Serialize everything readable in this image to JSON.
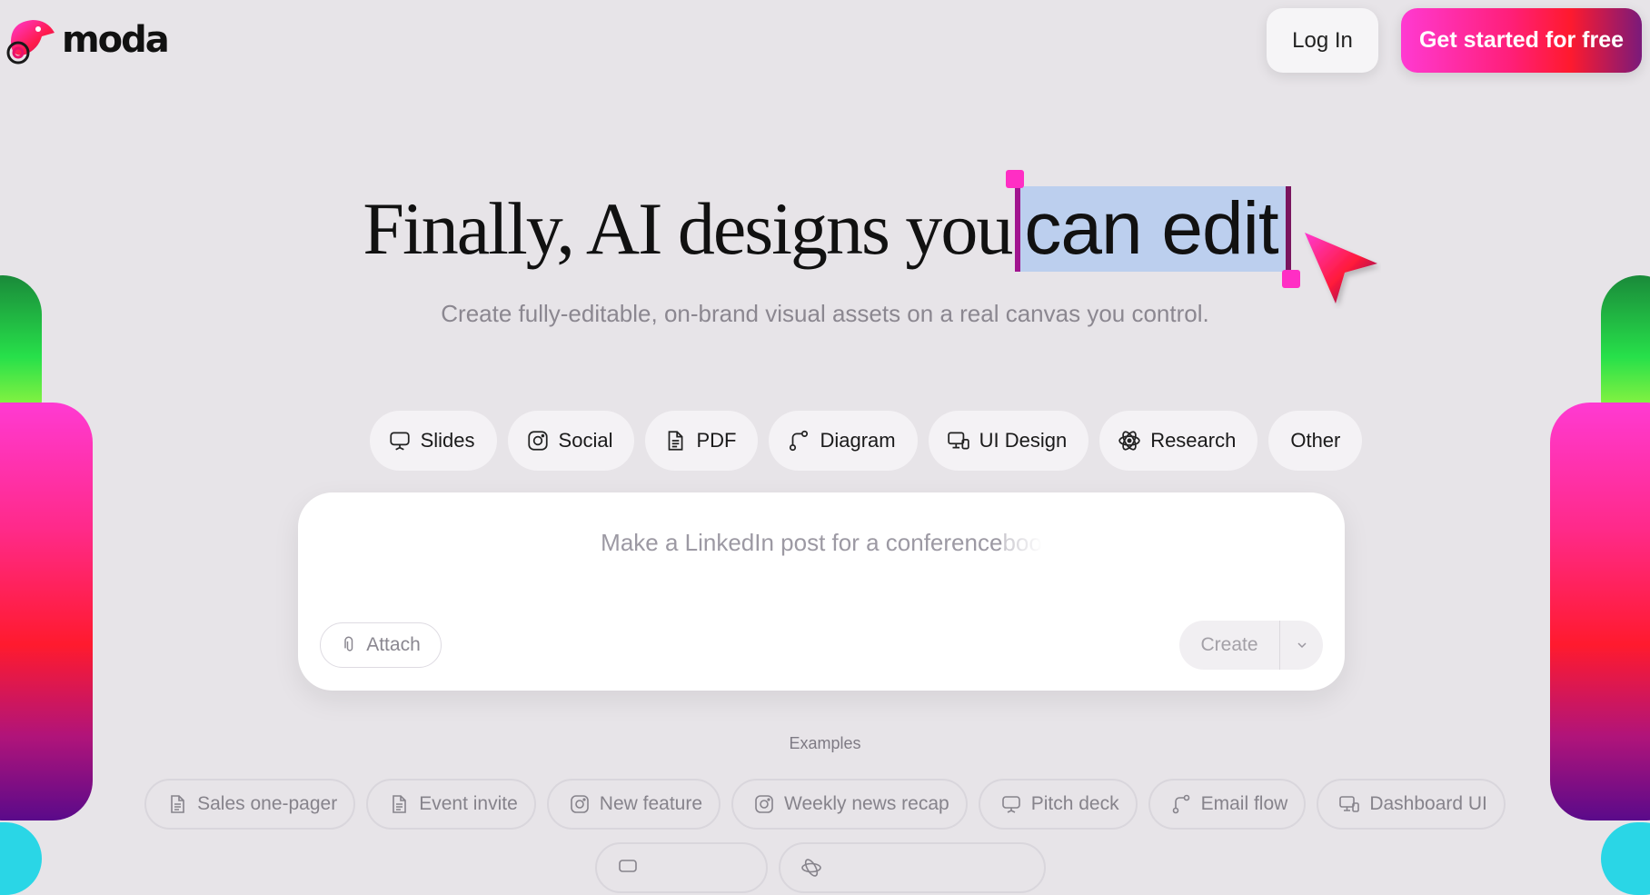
{
  "brand": {
    "name": "moda"
  },
  "header": {
    "login_label": "Log In",
    "cta_label": "Get started for free"
  },
  "hero": {
    "headline_prefix": "Finally, AI designs you",
    "headline_highlight": "can edit",
    "subheadline": "Create fully-editable, on-brand visual assets on a real canvas you control."
  },
  "categories": [
    {
      "label": "Slides",
      "icon": "presentation-icon"
    },
    {
      "label": "Social",
      "icon": "instagram-icon"
    },
    {
      "label": "PDF",
      "icon": "document-icon"
    },
    {
      "label": "Diagram",
      "icon": "flow-icon"
    },
    {
      "label": "UI Design",
      "icon": "devices-icon"
    },
    {
      "label": "Research",
      "icon": "atom-icon"
    },
    {
      "label": "Other",
      "icon": ""
    }
  ],
  "prompt": {
    "placeholder_visible": "Make a LinkedIn post for a conference ",
    "placeholder_fading": "boo",
    "attach_label": "Attach",
    "create_label": "Create"
  },
  "examples_label": "Examples",
  "examples": [
    {
      "label": "Sales one-pager",
      "icon": "document-icon"
    },
    {
      "label": "Event invite",
      "icon": "document-icon"
    },
    {
      "label": "New feature",
      "icon": "instagram-icon"
    },
    {
      "label": "Weekly news recap",
      "icon": "instagram-icon"
    },
    {
      "label": "Pitch deck",
      "icon": "presentation-icon"
    },
    {
      "label": "Email flow",
      "icon": "flow-icon"
    },
    {
      "label": "Dashboard UI",
      "icon": "devices-icon"
    }
  ],
  "colors": {
    "background": "#e7e4e8",
    "accent_pink": "#ff2ec4",
    "selection": "#bccfee"
  }
}
